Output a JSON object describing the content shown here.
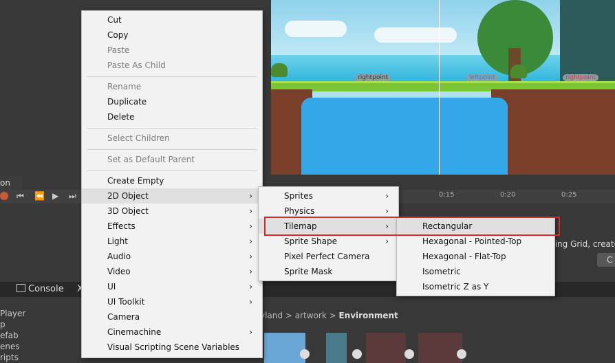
{
  "scene": {
    "labels": [
      "rightpoint",
      "leftpoint",
      "rightpoint"
    ]
  },
  "animation_tab": {
    "label": "on"
  },
  "timeline": {
    "marks": [
      "0:15",
      "0:20",
      "0:25"
    ]
  },
  "inspector": {
    "hint": "ting Grid, create",
    "button": "C"
  },
  "console_tab": {
    "label": "Console",
    "close": "X"
  },
  "project_list": [
    "Player",
    "p",
    "efab",
    "enes",
    "ripts"
  ],
  "breadcrumb": {
    "items": [
      "yland",
      "artwork"
    ],
    "current": "Environment",
    "separator": ">"
  },
  "context_menu": {
    "items": [
      {
        "label": "Cut",
        "enabled": true
      },
      {
        "label": "Copy",
        "enabled": true
      },
      {
        "label": "Paste",
        "enabled": false
      },
      {
        "label": "Paste As Child",
        "enabled": false
      },
      {
        "label": "Rename",
        "enabled": false
      },
      {
        "label": "Duplicate",
        "enabled": true
      },
      {
        "label": "Delete",
        "enabled": true
      },
      {
        "label": "Select Children",
        "enabled": false
      },
      {
        "label": "Set as Default Parent",
        "enabled": false
      },
      {
        "label": "Create Empty",
        "enabled": true
      },
      {
        "label": "2D Object",
        "enabled": true,
        "submenu": true
      },
      {
        "label": "3D Object",
        "enabled": true,
        "submenu": true
      },
      {
        "label": "Effects",
        "enabled": true,
        "submenu": true
      },
      {
        "label": "Light",
        "enabled": true,
        "submenu": true
      },
      {
        "label": "Audio",
        "enabled": true,
        "submenu": true
      },
      {
        "label": "Video",
        "enabled": true,
        "submenu": true
      },
      {
        "label": "UI",
        "enabled": true,
        "submenu": true
      },
      {
        "label": "UI Toolkit",
        "enabled": true,
        "submenu": true
      },
      {
        "label": "Camera",
        "enabled": true
      },
      {
        "label": "Cinemachine",
        "enabled": true,
        "submenu": true
      },
      {
        "label": "Visual Scripting Scene Variables",
        "enabled": true
      }
    ]
  },
  "submenu_2d": {
    "items": [
      "Sprites",
      "Physics",
      "Tilemap",
      "Sprite Shape",
      "Pixel Perfect Camera",
      "Sprite Mask"
    ]
  },
  "submenu_tilemap": {
    "items": [
      "Rectangular",
      "Hexagonal - Pointed-Top",
      "Hexagonal - Flat-Top",
      "Isometric",
      "Isometric Z as Y"
    ]
  },
  "colors": {
    "highlight_box": "#d42a2a",
    "menu_bg": "#f2f2f2",
    "disabled_text": "#7d7d7d"
  }
}
